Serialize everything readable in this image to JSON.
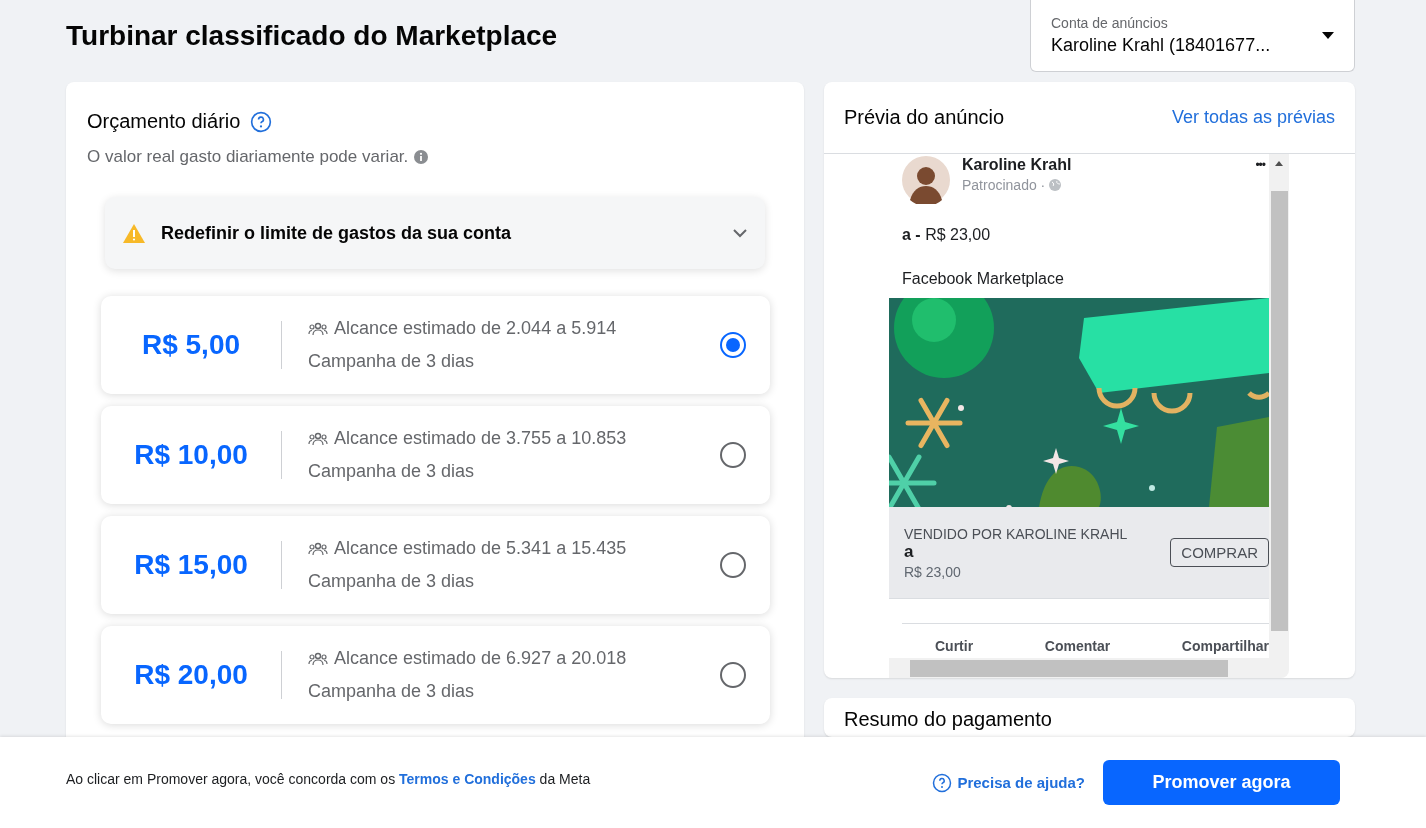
{
  "title": "Turbinar classificado do Marketplace",
  "account": {
    "label": "Conta de anúncios",
    "value": "Karoline Krahl (18401677..."
  },
  "budget": {
    "title": "Orçamento diário",
    "subtitle": "O valor real gasto diariamente pode variar.",
    "alert": {
      "text": "Redefinir o limite de gastos da sua conta",
      "expanded": false
    },
    "options": [
      {
        "price": "R$ 5,00",
        "reach": "Alcance estimado de 2.044 a 5.914",
        "duration": "Campanha de 3 dias",
        "selected": true
      },
      {
        "price": "R$ 10,00",
        "reach": "Alcance estimado de 3.755 a 10.853",
        "duration": "Campanha de 3 dias",
        "selected": false
      },
      {
        "price": "R$ 15,00",
        "reach": "Alcance estimado de 5.341 a 15.435",
        "duration": "Campanha de 3 dias",
        "selected": false
      },
      {
        "price": "R$ 20,00",
        "reach": "Alcance estimado de 6.927 a 20.018",
        "duration": "Campanha de 3 dias",
        "selected": false
      }
    ]
  },
  "preview": {
    "title": "Prévia do anúncio",
    "link": "Ver todas as prévias",
    "post": {
      "author": "Karoline Krahl",
      "sponsored": "Patrocinado ·",
      "more": "•••",
      "text_bold": "a -",
      "text": "R$ 23,00",
      "caption": "Facebook Marketplace",
      "image": {
        "kind": "picture"
      },
      "seller": "VENDIDO POR KAROLINE KRAHL",
      "item": "a",
      "price": "R$ 23,00",
      "button": "COMPRAR",
      "actions": [
        "Curtir",
        "Comentar",
        "Compartilhar"
      ]
    }
  },
  "payment": {
    "title": "Resumo do pagamento"
  },
  "footer": {
    "text_before": "Ao clicar em Promover agora, você concorda com os",
    "link": "Termos e Condições",
    "text_after": "da Meta",
    "help": "Precisa de ajuda?",
    "button": "Promover agora"
  }
}
